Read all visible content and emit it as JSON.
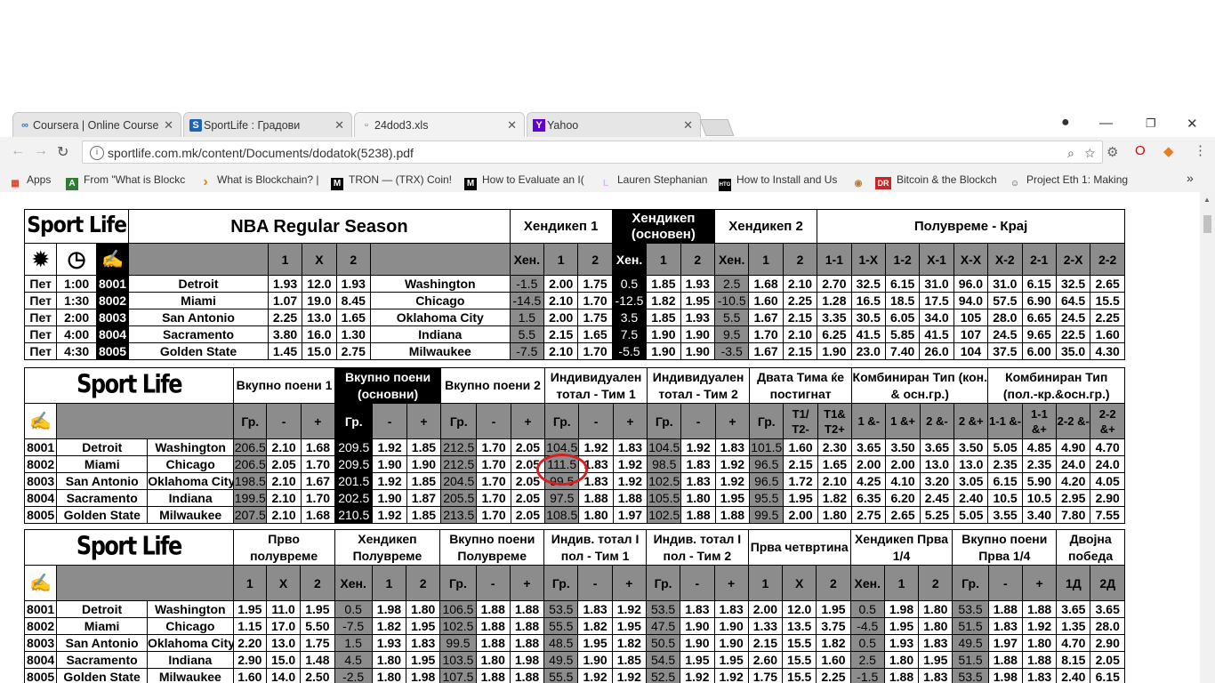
{
  "tabs": [
    {
      "title": "Coursera | Online Course",
      "icon": "∞",
      "color": "#2a73cc"
    },
    {
      "title": "SportLife : Градови",
      "icon": "S",
      "color": "#1e63b0"
    },
    {
      "title": "24dod3.xls",
      "icon": "▫",
      "color": "#666"
    },
    {
      "title": "Yahoo",
      "icon": "Y",
      "color": "#5f01d1"
    }
  ],
  "address": {
    "url": "sportlife.com.mk/content/Documents/dodatok(5238).pdf"
  },
  "bookmarks": [
    {
      "label": "Apps",
      "icon": "▦",
      "color": "#e0442c"
    },
    {
      "label": "From \"What is Blockc",
      "icon": "A",
      "color": "#2e7d32"
    },
    {
      "label": "What is Blockchain? |",
      "icon": "›",
      "color": "#f57c00"
    },
    {
      "label": "TRON — (TRX) Coin!",
      "icon": "M",
      "color": "#000"
    },
    {
      "label": "How to Evaluate an I(",
      "icon": "M",
      "color": "#000"
    },
    {
      "label": "Lauren Stephanian",
      "icon": "L",
      "color": "#e0b0ff"
    },
    {
      "label": "How to Install and Us",
      "icon": "HTG",
      "color": "#000"
    },
    {
      "label": "",
      "icon": "◉",
      "color": "#b08040"
    },
    {
      "label": "Bitcoin & the Blockch",
      "icon": "DR",
      "color": "#c62828"
    },
    {
      "label": "Project Eth 1: Making",
      "icon": "☺",
      "color": "#444"
    }
  ],
  "t1": {
    "brand": "Sport Life",
    "title": "NBA Regular Season",
    "hendikep1": "Хендикеп 1",
    "hendikep_osn": "Хендикеп (основен)",
    "hendikep2": "Хендикеп 2",
    "poluvreme": "Полувреме - Крај",
    "h1x2": [
      "1",
      "X",
      "2"
    ],
    "hen": "Хен.",
    "h12": [
      "1",
      "2"
    ],
    "pk": [
      "1-1",
      "1-X",
      "1-2",
      "X-1",
      "X-X",
      "X-2",
      "2-1",
      "2-X",
      "2-2"
    ],
    "rows": [
      [
        "Пет",
        "1:00",
        "8001",
        "Detroit",
        "1.93",
        "12.0",
        "1.93",
        "Washington",
        "-1.5",
        "2.00",
        "1.75",
        "0.5",
        "1.85",
        "1.93",
        "2.5",
        "1.68",
        "2.10",
        "2.70",
        "32.5",
        "6.15",
        "31.0",
        "96.0",
        "31.0",
        "6.15",
        "32.5",
        "2.65"
      ],
      [
        "Пет",
        "1:30",
        "8002",
        "Miami",
        "1.07",
        "19.0",
        "8.45",
        "Chicago",
        "-14.5",
        "2.10",
        "1.70",
        "-12.5",
        "1.82",
        "1.95",
        "-10.5",
        "1.60",
        "2.25",
        "1.28",
        "16.5",
        "18.5",
        "17.5",
        "94.0",
        "57.5",
        "6.90",
        "64.5",
        "15.5"
      ],
      [
        "Пет",
        "2:00",
        "8003",
        "San Antonio",
        "2.25",
        "13.0",
        "1.65",
        "Oklahoma City",
        "1.5",
        "2.00",
        "1.75",
        "3.5",
        "1.85",
        "1.93",
        "5.5",
        "1.67",
        "2.15",
        "3.35",
        "30.5",
        "6.05",
        "34.0",
        "105",
        "28.0",
        "6.65",
        "24.5",
        "2.25"
      ],
      [
        "Пет",
        "4:00",
        "8004",
        "Sacramento",
        "3.80",
        "16.0",
        "1.30",
        "Indiana",
        "5.5",
        "2.15",
        "1.65",
        "7.5",
        "1.90",
        "1.90",
        "9.5",
        "1.70",
        "2.10",
        "6.25",
        "41.5",
        "5.85",
        "41.5",
        "107",
        "24.5",
        "9.65",
        "22.5",
        "1.60"
      ],
      [
        "Пет",
        "4:30",
        "8005",
        "Golden State",
        "1.45",
        "15.0",
        "2.75",
        "Milwaukee",
        "-7.5",
        "2.10",
        "1.70",
        "-5.5",
        "1.90",
        "1.90",
        "-3.5",
        "1.67",
        "2.15",
        "1.90",
        "23.0",
        "7.40",
        "26.0",
        "104",
        "37.5",
        "6.00",
        "35.0",
        "4.30"
      ]
    ]
  },
  "t2": {
    "brand": "Sport Life",
    "groups": [
      "Вкупно поени 1",
      "Вкупно поени (основни)",
      "Вкупно поени 2",
      "Индивидуален тотал - Тим 1",
      "Индивидуален тотал - Тим 2",
      "Двата Тима ќе постигнат",
      "Комбиниран Тип (кон. & осн.гр.)",
      "Комбиниран Тип (пол.-кр.&осн.гр.)"
    ],
    "gr": "Гр.",
    "minus": "-",
    "plus": "+",
    "t1t2": [
      "Т1/ Т2-",
      "Т1& Т2+"
    ],
    "komb1": [
      "1 &-",
      "1 &+",
      "2 &-",
      "2 &+"
    ],
    "komb2": [
      "1-1 &-",
      "1-1 &+",
      "2-2 &-",
      "2-2 &+"
    ],
    "rows": [
      [
        "8001",
        "Detroit",
        "Washington",
        "206.5",
        "2.10",
        "1.68",
        "209.5",
        "1.92",
        "1.85",
        "212.5",
        "1.70",
        "2.05",
        "104.5",
        "1.92",
        "1.83",
        "104.5",
        "1.92",
        "1.83",
        "101.5",
        "1.60",
        "2.30",
        "3.65",
        "3.50",
        "3.65",
        "3.50",
        "5.05",
        "4.85",
        "4.90",
        "4.70"
      ],
      [
        "8002",
        "Miami",
        "Chicago",
        "206.5",
        "2.05",
        "1.70",
        "209.5",
        "1.90",
        "1.90",
        "212.5",
        "1.70",
        "2.05",
        "111.5",
        "1.83",
        "1.92",
        "98.5",
        "1.83",
        "1.92",
        "96.5",
        "2.15",
        "1.65",
        "2.00",
        "2.00",
        "13.0",
        "13.0",
        "2.35",
        "2.35",
        "24.0",
        "24.0"
      ],
      [
        "8003",
        "San Antonio",
        "Oklahoma City",
        "198.5",
        "2.10",
        "1.67",
        "201.5",
        "1.92",
        "1.85",
        "204.5",
        "1.70",
        "2.05",
        "99.5",
        "1.83",
        "1.92",
        "102.5",
        "1.83",
        "1.92",
        "96.5",
        "1.72",
        "2.10",
        "4.25",
        "4.10",
        "3.20",
        "3.05",
        "6.15",
        "5.90",
        "4.20",
        "4.05"
      ],
      [
        "8004",
        "Sacramento",
        "Indiana",
        "199.5",
        "2.10",
        "1.70",
        "202.5",
        "1.90",
        "1.87",
        "205.5",
        "1.70",
        "2.05",
        "97.5",
        "1.88",
        "1.88",
        "105.5",
        "1.80",
        "1.95",
        "95.5",
        "1.95",
        "1.82",
        "6.35",
        "6.20",
        "2.45",
        "2.40",
        "10.5",
        "10.5",
        "2.95",
        "2.90"
      ],
      [
        "8005",
        "Golden State",
        "Milwaukee",
        "207.5",
        "2.10",
        "1.68",
        "210.5",
        "1.92",
        "1.85",
        "213.5",
        "1.70",
        "2.05",
        "108.5",
        "1.80",
        "1.97",
        "102.5",
        "1.88",
        "1.88",
        "99.5",
        "2.00",
        "1.80",
        "2.75",
        "2.65",
        "5.25",
        "5.05",
        "3.55",
        "3.40",
        "7.80",
        "7.55"
      ]
    ]
  },
  "t3": {
    "brand": "Sport Life",
    "groups": [
      "Прво полувреме",
      "Хендикеп Полувреме",
      "Вкупно поени Полувреме",
      "Индив. тотал I пол - Тим 1",
      "Индив. тотал I пол - Тим 2",
      "Прва четвртина",
      "Хендикеп Прва 1/4",
      "Вкупно поени Прва 1/4",
      "Двојна победа"
    ],
    "h1x2": [
      "1",
      "X",
      "2"
    ],
    "hen": "Хен.",
    "h12": [
      "1",
      "2"
    ],
    "gr": "Гр.",
    "minus": "-",
    "plus": "+",
    "dp": [
      "1Д",
      "2Д"
    ],
    "rows": [
      [
        "8001",
        "Detroit",
        "Washington",
        "1.95",
        "11.0",
        "1.95",
        "0.5",
        "1.98",
        "1.80",
        "106.5",
        "1.88",
        "1.88",
        "53.5",
        "1.83",
        "1.92",
        "53.5",
        "1.83",
        "1.83",
        "2.00",
        "12.0",
        "1.95",
        "0.5",
        "1.98",
        "1.80",
        "53.5",
        "1.88",
        "1.88",
        "3.65",
        "3.65"
      ],
      [
        "8002",
        "Miami",
        "Chicago",
        "1.15",
        "17.0",
        "5.50",
        "-7.5",
        "1.82",
        "1.95",
        "102.5",
        "1.88",
        "1.88",
        "55.5",
        "1.82",
        "1.95",
        "47.5",
        "1.90",
        "1.90",
        "1.33",
        "13.5",
        "3.75",
        "-4.5",
        "1.95",
        "1.80",
        "51.5",
        "1.83",
        "1.92",
        "1.35",
        "28.0"
      ],
      [
        "8003",
        "San Antonio",
        "Oklahoma City",
        "2.20",
        "13.0",
        "1.75",
        "1.5",
        "1.93",
        "1.83",
        "99.5",
        "1.88",
        "1.88",
        "48.5",
        "1.95",
        "1.82",
        "50.5",
        "1.90",
        "1.90",
        "2.15",
        "15.5",
        "1.82",
        "0.5",
        "1.93",
        "1.83",
        "49.5",
        "1.97",
        "1.80",
        "4.70",
        "2.90"
      ],
      [
        "8004",
        "Sacramento",
        "Indiana",
        "2.90",
        "15.0",
        "1.48",
        "4.5",
        "1.80",
        "1.95",
        "103.5",
        "1.80",
        "1.98",
        "49.5",
        "1.90",
        "1.85",
        "54.5",
        "1.95",
        "1.95",
        "2.60",
        "15.5",
        "1.60",
        "2.5",
        "1.80",
        "1.95",
        "51.5",
        "1.88",
        "1.88",
        "8.15",
        "2.05"
      ],
      [
        "8005",
        "Golden State",
        "Milwaukee",
        "1.60",
        "14.0",
        "2.50",
        "-2.5",
        "1.80",
        "1.98",
        "107.5",
        "1.88",
        "1.88",
        "55.5",
        "1.92",
        "1.92",
        "52.5",
        "1.92",
        "1.92",
        "1.75",
        "15.5",
        "2.25",
        "-1.5",
        "1.88",
        "1.83",
        "53.5",
        "1.98",
        "1.83",
        "2.40",
        "6.15"
      ]
    ]
  }
}
